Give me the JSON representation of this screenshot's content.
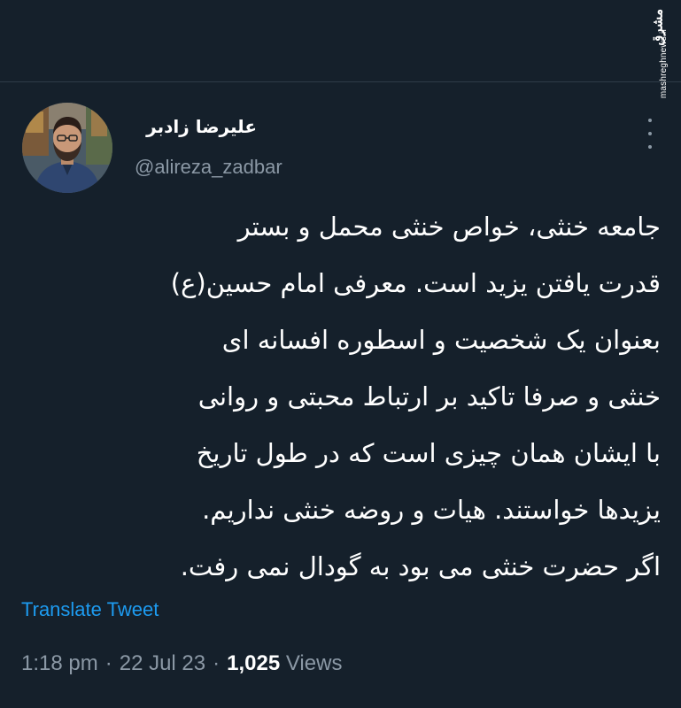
{
  "watermark": {
    "logo_text": "مشرق",
    "site": "mashreghnews.ir"
  },
  "author": {
    "name": "علیرضا زادبر",
    "handle": "@alireza_zadbar",
    "avatar_icon": "profile-photo"
  },
  "tweet": {
    "lines": [
      "جامعه خنثی، خواص خنثی محمل و بستر",
      "قدرت یافتن یزید است. معرفی امام حسین(ع)",
      "بعنوان یک شخصیت و اسطوره افسانه ای",
      "خنثی و صرفا تاکید بر ارتباط محبتی و روانی",
      "با ایشان همان چیزی است که در طول تاریخ",
      "یزیدها خواستند. هیات و روضه خنثی نداریم.",
      "اگر حضرت خنثی می بود به گودال نمی رفت."
    ],
    "translate_label": "Translate Tweet"
  },
  "meta": {
    "time": "1:18 pm",
    "separator": "·",
    "date": "22 Jul 23",
    "views_count": "1,025",
    "views_label": "Views"
  },
  "colors": {
    "background": "#15202b",
    "text": "#ffffff",
    "secondary_text": "#8b98a5",
    "link": "#1d9bf0"
  }
}
